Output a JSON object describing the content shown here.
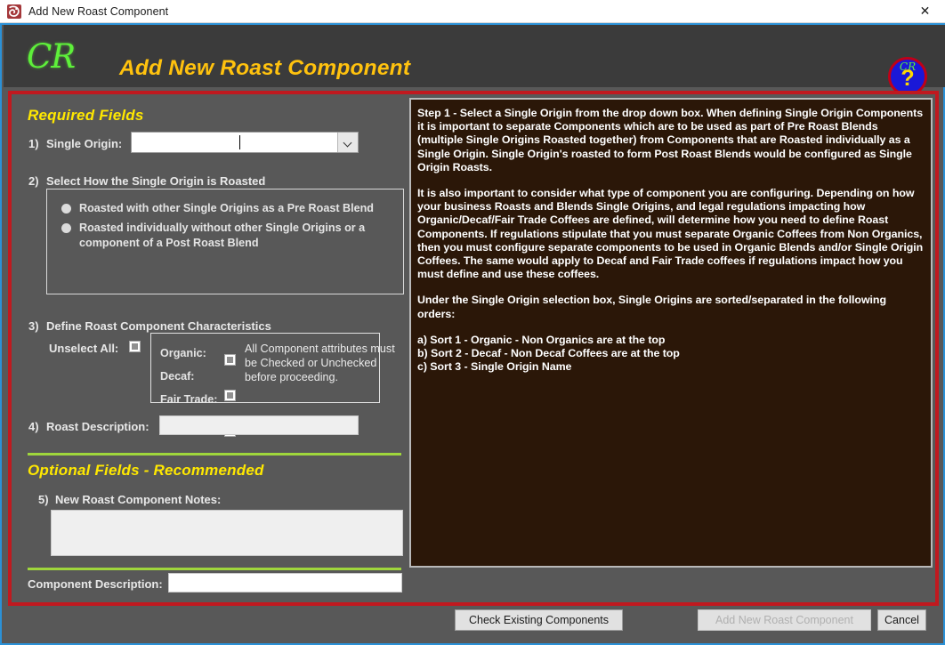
{
  "window": {
    "title": "Add New Roast Component",
    "app_icon": "access-database-icon",
    "close_label": "✕"
  },
  "banner": {
    "logo": "CR",
    "title": "Add New Roast Component",
    "help_badge": {
      "cr": "CR",
      "mark": "?"
    }
  },
  "left": {
    "required_heading": "Required Fields",
    "step1": {
      "number": "1)",
      "label": "Single Origin:",
      "value": "",
      "placeholder": ""
    },
    "step2": {
      "number": "2)",
      "label": "Select How the Single Origin is Roasted",
      "options": [
        "Roasted with other Single Origins as a Pre Roast Blend",
        "Roasted individually without other Single Origins or a component of a Post Roast Blend"
      ]
    },
    "step3": {
      "number": "3)",
      "label": "Define Roast Component Characteristics",
      "unselect_all_label": "Unselect All:",
      "attributes": [
        {
          "label": "Organic:"
        },
        {
          "label": "Decaf:"
        },
        {
          "label": "Fair Trade:"
        }
      ],
      "note": "All Component attributes must be Checked or Unchecked before proceeding."
    },
    "step4": {
      "number": "4)",
      "label": "Roast Description:",
      "value": ""
    },
    "optional_heading": "Optional Fields - Recommended",
    "step5": {
      "number": "5)",
      "label": "New Roast Component Notes:",
      "value": ""
    },
    "component_description": {
      "label": "Component Description:",
      "value": ""
    }
  },
  "info": {
    "paragraphs": [
      "Step 1 - Select a Single Origin from the drop down box.  When defining Single Origin Components it is important to separate Components which are to be used as part of Pre Roast Blends (multiple Single Origins Roasted together) from Components that are Roasted individually as a Single Origin.  Single Origin's roasted to form Post Roast Blends would be configured as Single Origin Roasts.",
      "It is also important to consider what type of component you are configuring.  Depending on how your business Roasts and Blends Single Origins, and legal regulations impacting how Organic/Decaf/Fair Trade Coffees are defined, will determine how you need to define Roast Components.  If regulations stipulate that you must separate Organic Coffees from Non Organics, then you must configure separate components to be used in Organic Blends and/or Single Origin Coffees.  The same would apply to Decaf and Fair Trade coffees if regulations impact how you must define and use these coffees.",
      "Under the Single Origin selection box, Single Origins are sorted/separated in the following orders:"
    ],
    "sort_list": [
      "a)  Sort 1 - Organic - Non Organics are at the top",
      "b)  Sort 2 - Decaf - Non Decaf Coffees are at the top",
      "c)  Sort 3 - Single Origin Name"
    ]
  },
  "footer": {
    "check_existing": "Check Existing Components",
    "add_component": "Add New Roast Component",
    "cancel": "Cancel"
  },
  "colors": {
    "accent_yellow": "#ffe800",
    "banner_title": "#ffc20e",
    "logo_green": "#5ef03a",
    "frame_red": "#c0191f",
    "rule_green": "#9fd63c",
    "panel_bg": "#2b1708",
    "window_border": "#2b91d7",
    "body_bg": "#585858"
  }
}
